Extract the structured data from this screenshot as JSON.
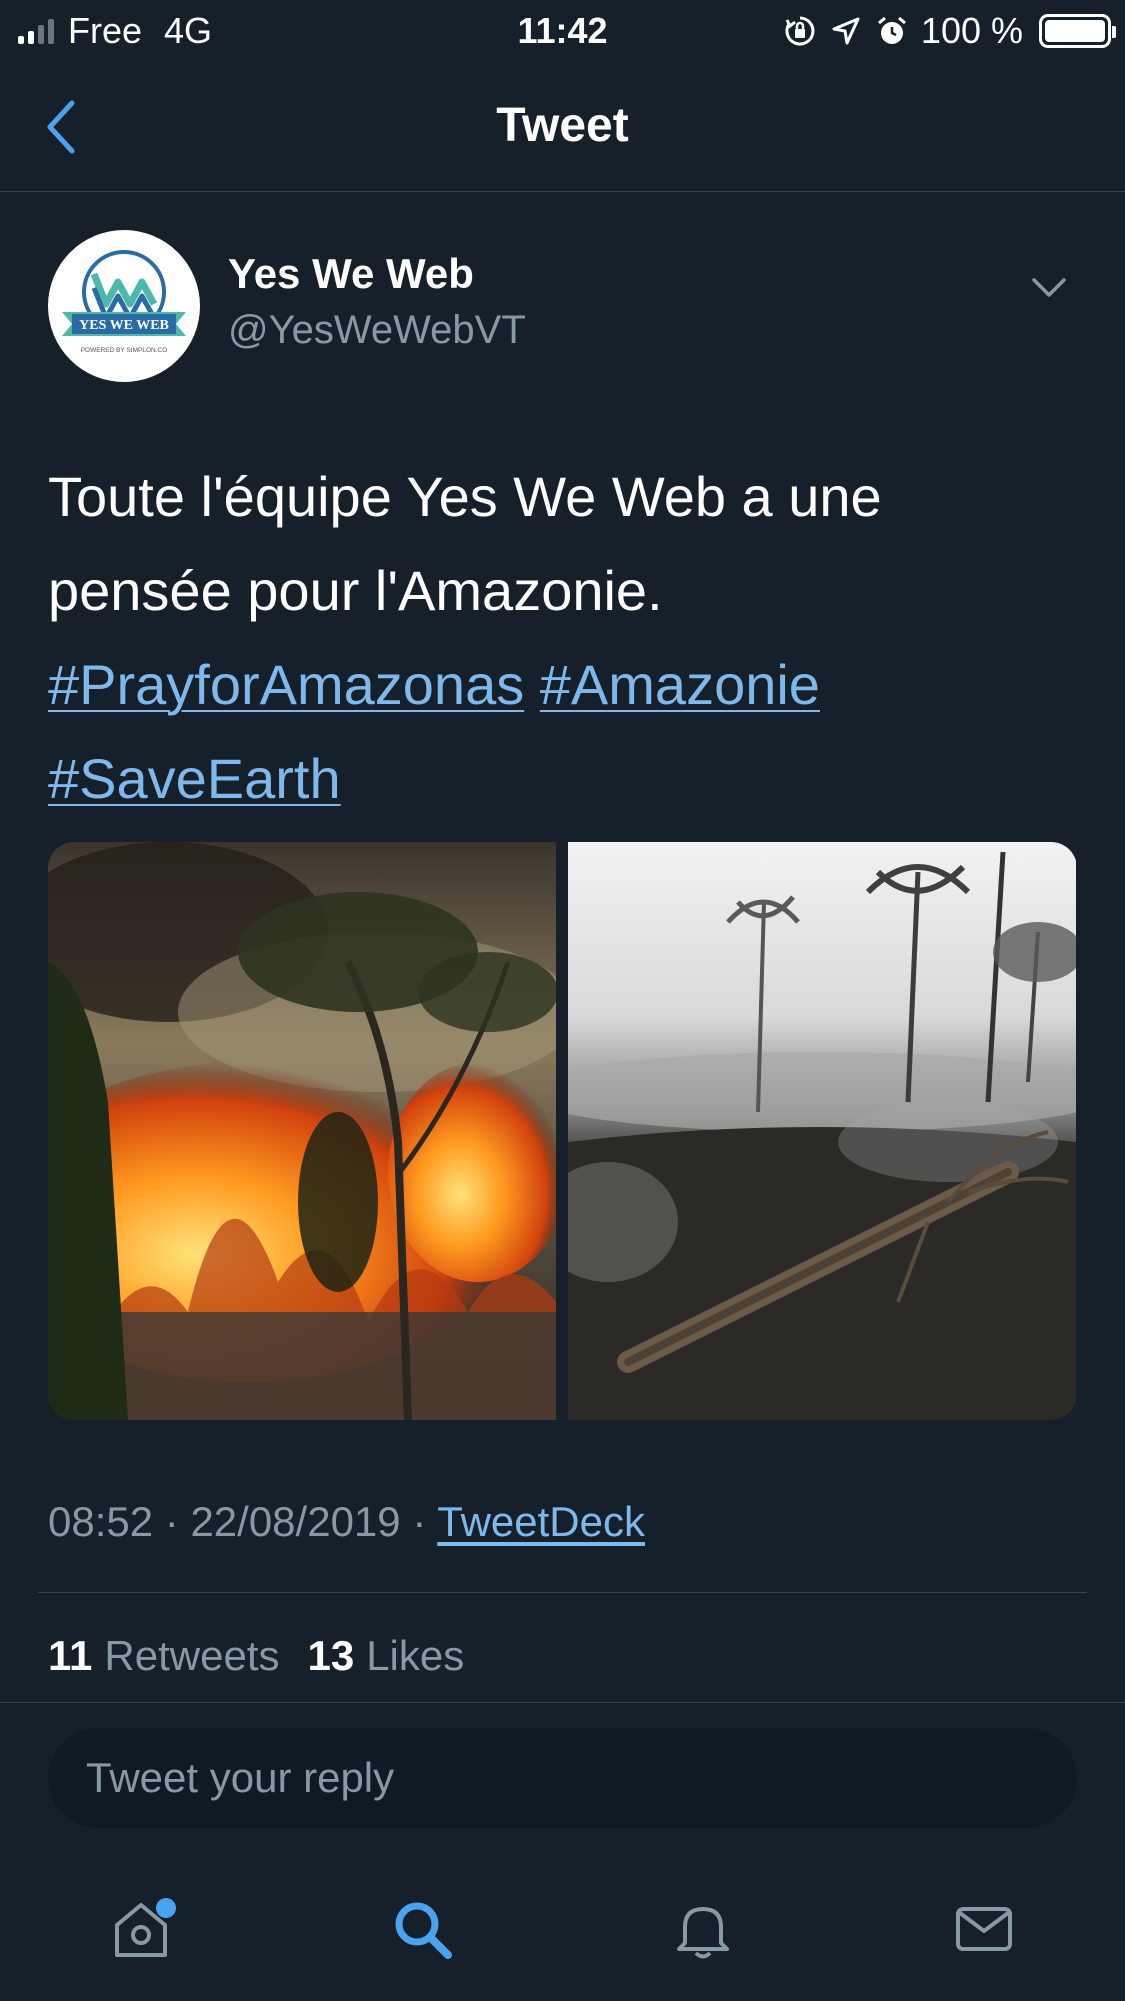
{
  "status_bar": {
    "carrier": "Free",
    "network": "4G",
    "time": "11:42",
    "battery": "100 %",
    "battery_level": 1.0
  },
  "nav": {
    "title": "Tweet"
  },
  "tweet": {
    "author_name": "Yes We Web",
    "author_handle": "@YesWeWebVT",
    "avatar_text": "YES WE WEB",
    "avatar_subtext": "POWERED BY SIMPLON.CO",
    "text": "Toute l'équipe Yes We Web a une pensée pour l'Amazonie.",
    "hashtags": [
      "#PrayforAmazonas",
      "#Amazonie",
      "#SaveEarth"
    ],
    "time": "08:52",
    "date": "22/08/2019",
    "source": "TweetDeck",
    "separator": " · ",
    "retweets_count": "11",
    "retweets_label": "Retweets",
    "likes_count": "13",
    "likes_label": "Likes"
  },
  "reply": {
    "placeholder": "Tweet your reply"
  },
  "colors": {
    "background": "#15202b",
    "link": "#7fb8ec",
    "secondary_text": "#8899a6",
    "accent": "#4aa3ef"
  },
  "tabs": [
    {
      "icon": "home-icon",
      "has_notification_dot": true
    },
    {
      "icon": "search-icon",
      "active": true
    },
    {
      "icon": "bell-icon"
    },
    {
      "icon": "mail-icon"
    }
  ]
}
